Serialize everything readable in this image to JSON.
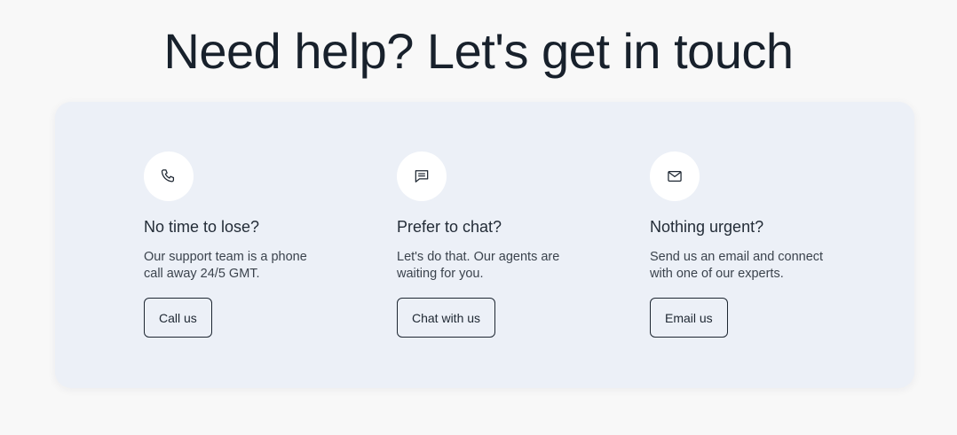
{
  "header": {
    "title": "Need help? Let's get in touch"
  },
  "contact_options": [
    {
      "icon": "phone-icon",
      "title": "No time to lose?",
      "description": "Our support team is a phone call away 24/5 GMT.",
      "button_label": "Call us"
    },
    {
      "icon": "chat-icon",
      "title": "Prefer to chat?",
      "description": "Let's do that. Our agents are waiting for you.",
      "button_label": "Chat with us"
    },
    {
      "icon": "mail-icon",
      "title": "Nothing urgent?",
      "description": "Send us an email and connect with one of our experts.",
      "button_label": "Email us"
    }
  ],
  "colors": {
    "page_background": "#f8f8f8",
    "card_background": "#ecf0f7",
    "text_primary": "#18212c",
    "button_border": "#1e2732"
  }
}
